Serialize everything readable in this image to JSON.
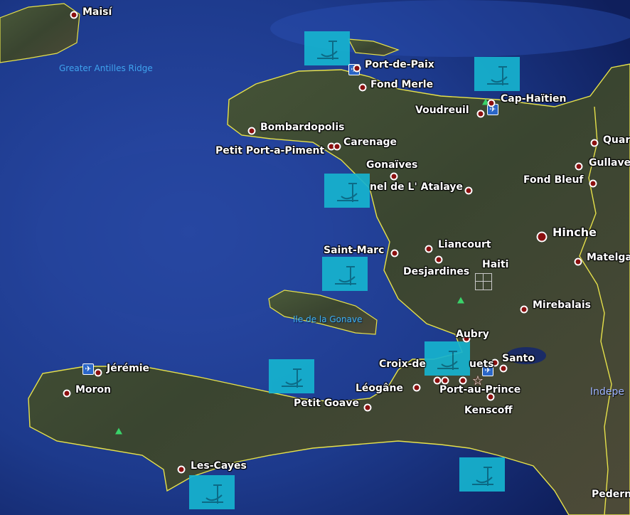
{
  "map": {
    "places": {
      "maisi": "Maisí",
      "port_de_paix": "Port-de-Paix",
      "fond_merle": "Fond Merle",
      "cap_haitien": "Cap-Haïtien",
      "voudreuil": "Voudreuil",
      "bombardopolis": "Bombardopolis",
      "carenage": "Carenage",
      "petit_port_a_piment": "Petit Port-a-Piment",
      "gonaives": "Gonaïves",
      "atalaye": "nel de L' Atalaye",
      "fond_bleuf": "Fond Bleuf",
      "gullave": "Gullave",
      "quar": "Quar",
      "hinche": "Hinche",
      "matelga": "Matelga",
      "liancourt": "Liancourt",
      "saint_marc": "Saint-Marc",
      "haiti": "Haiti",
      "desjardines": "Desjardines",
      "mirebalais": "Mirebalais",
      "aubry": "Aubry",
      "croix_des_bouquets": "Croix-de",
      "croix_des_bouquets_tail": "uets",
      "santo": "Santo",
      "jeremie": "Jérémie",
      "moron": "Moron",
      "leogane": "Léogâne",
      "port_au_prince": "Port-au-Prince",
      "kenscoff": "Kenscoff",
      "petit_goave": "Petit Goave",
      "les_cayes": "Les-Cayes",
      "indep": "Indepe",
      "pedern": "Pedern"
    },
    "features": {
      "greater_antilles_ridge": "Greater Antilles Ridge",
      "ile_de_la_gonave": "Ile de la Gonave"
    },
    "icons": {
      "shipwreck": "anchor-icon",
      "airport": "airport-icon",
      "capital": "star-icon",
      "volcano": "peak-icon"
    },
    "colors": {
      "ocean": "#1d3a8c",
      "land": "#3b4a32",
      "border": "#e6e14a",
      "marker_fill": "#8b1010",
      "shipwreck_box": "#16b3cf",
      "label": "#ffffff",
      "water_label": "#3fa3ee"
    }
  }
}
